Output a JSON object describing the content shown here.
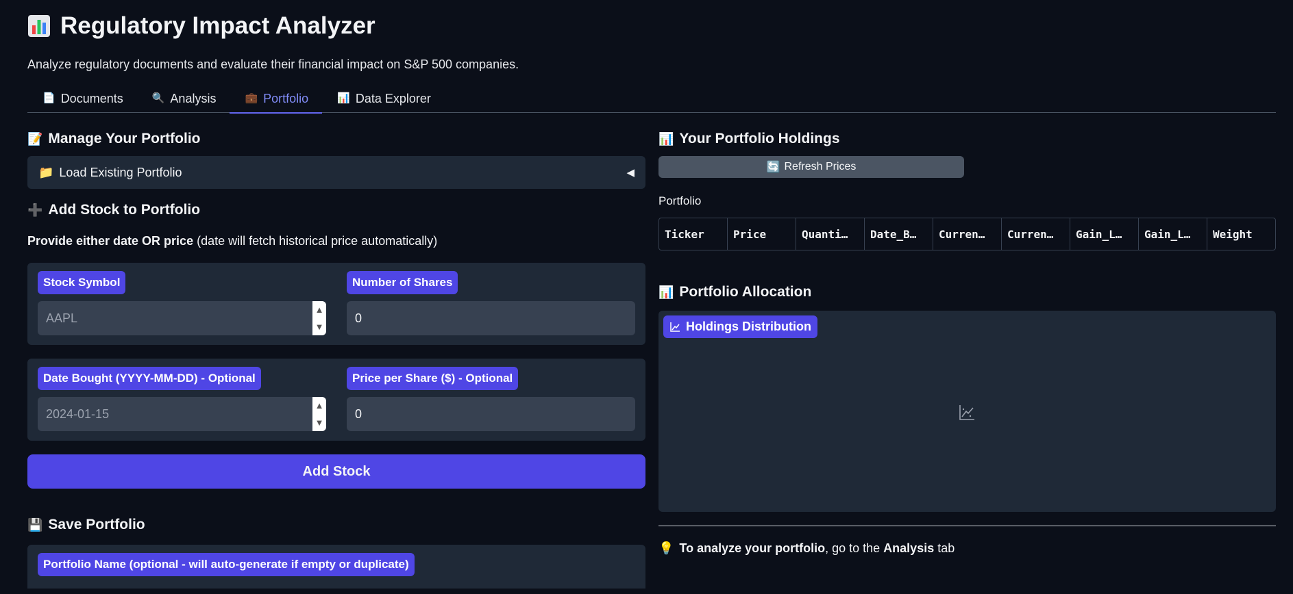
{
  "app": {
    "title": "Regulatory Impact Analyzer",
    "title_icon": "bar-chart-icon",
    "subtitle": "Analyze regulatory documents and evaluate their financial impact on S&P 500 companies."
  },
  "tabs": [
    {
      "icon": "📄",
      "label": "Documents"
    },
    {
      "icon": "🔍",
      "label": "Analysis"
    },
    {
      "icon": "💼",
      "label": "Portfolio",
      "active": true
    },
    {
      "icon": "📊",
      "label": "Data Explorer"
    }
  ],
  "manage": {
    "icon": "📝",
    "heading": "Manage Your Portfolio",
    "load_accordion": {
      "icon": "📁",
      "label": "Load Existing Portfolio",
      "toggle": "◀"
    },
    "add_heading_icon": "➕",
    "add_heading": "Add Stock to Portfolio",
    "instructions_bold": "Provide either date OR price",
    "instructions_rest": " (date will fetch historical price automatically)",
    "stock_symbol": {
      "label": "Stock Symbol",
      "placeholder": "AAPL"
    },
    "num_shares": {
      "label": "Number of Shares",
      "value": "0"
    },
    "date_bought": {
      "label": "Date Bought (YYYY-MM-DD) - Optional",
      "placeholder": "2024-01-15"
    },
    "price_per_share": {
      "label": "Price per Share ($) - Optional",
      "value": "0"
    },
    "add_button": "Add Stock",
    "save_icon": "💾",
    "save_heading": "Save Portfolio",
    "portfolio_name_label": "Portfolio Name (optional - will auto-generate if empty or duplicate)"
  },
  "holdings": {
    "icon": "📊",
    "heading": "Your Portfolio Holdings",
    "refresh_icon": "🔄",
    "refresh_label": "Refresh Prices",
    "table_label": "Portfolio",
    "columns": [
      "Ticker",
      "Price",
      "Quanti…",
      "Date_B…",
      "Curren…",
      "Curren…",
      "Gain_L…",
      "Gain_L…",
      "Weight"
    ]
  },
  "allocation": {
    "icon": "📊",
    "heading": "Portfolio Allocation",
    "plot_label": "Holdings Distribution"
  },
  "note": {
    "icon": "💡",
    "bold1": "To analyze your portfolio",
    "text1": ", go to the ",
    "bold2": "Analysis",
    "text2": " tab"
  }
}
